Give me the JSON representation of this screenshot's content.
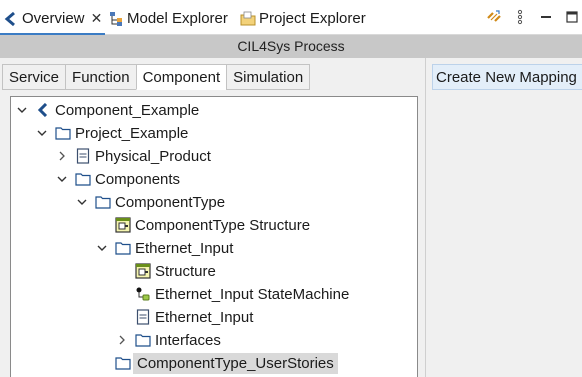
{
  "view_tabs": [
    {
      "label": "Overview",
      "active": true,
      "icon": "overview-icon"
    },
    {
      "label": "Model Explorer",
      "active": false,
      "icon": "model-explorer-icon"
    },
    {
      "label": "Project Explorer",
      "active": false,
      "icon": "project-explorer-icon"
    }
  ],
  "close_glyph": "✕",
  "toolbar_icons": [
    "sync-link-icon",
    "view-menu-icon",
    "minimize-icon",
    "maximize-icon"
  ],
  "process_title": "CIL4Sys Process",
  "content_tabs": [
    {
      "label": "Service",
      "active": false
    },
    {
      "label": "Function",
      "active": false
    },
    {
      "label": "Component",
      "active": true
    },
    {
      "label": "Simulation",
      "active": false
    }
  ],
  "tree": [
    {
      "label": "Component_Example",
      "depth": 0,
      "toggle": "expanded",
      "icon": "model-root-icon"
    },
    {
      "label": "Project_Example",
      "depth": 1,
      "toggle": "expanded",
      "icon": "folder-icon"
    },
    {
      "label": "Physical_Product",
      "depth": 2,
      "toggle": "collapsed",
      "icon": "document-icon"
    },
    {
      "label": "Components",
      "depth": 2,
      "toggle": "expanded",
      "icon": "folder-icon"
    },
    {
      "label": "ComponentType",
      "depth": 3,
      "toggle": "expanded",
      "icon": "folder-icon"
    },
    {
      "label": "ComponentType Structure",
      "depth": 4,
      "toggle": "none",
      "icon": "structure-diagram-icon"
    },
    {
      "label": "Ethernet_Input",
      "depth": 4,
      "toggle": "expanded",
      "icon": "folder-icon"
    },
    {
      "label": "Structure",
      "depth": 5,
      "toggle": "none",
      "icon": "structure-diagram-icon"
    },
    {
      "label": "Ethernet_Input StateMachine",
      "depth": 5,
      "toggle": "none",
      "icon": "state-machine-icon"
    },
    {
      "label": "Ethernet_Input",
      "depth": 5,
      "toggle": "none",
      "icon": "document-icon"
    },
    {
      "label": "Interfaces",
      "depth": 5,
      "toggle": "collapsed",
      "icon": "folder-icon"
    },
    {
      "label": "ComponentType_UserStories",
      "depth": 4,
      "toggle": "none",
      "icon": "folder-icon",
      "selected": true
    }
  ],
  "mapping_button": "Create New Mapping",
  "colors": {
    "accent": "#3b7cc4",
    "folder": "#1f4f8b",
    "title_bar": "#c8c8c8",
    "selection": "#d9d9d9",
    "mapping_button_bg": "#e3eef9",
    "structure_icon": "#6a8f1a",
    "sync_icon": "#d08a18"
  }
}
